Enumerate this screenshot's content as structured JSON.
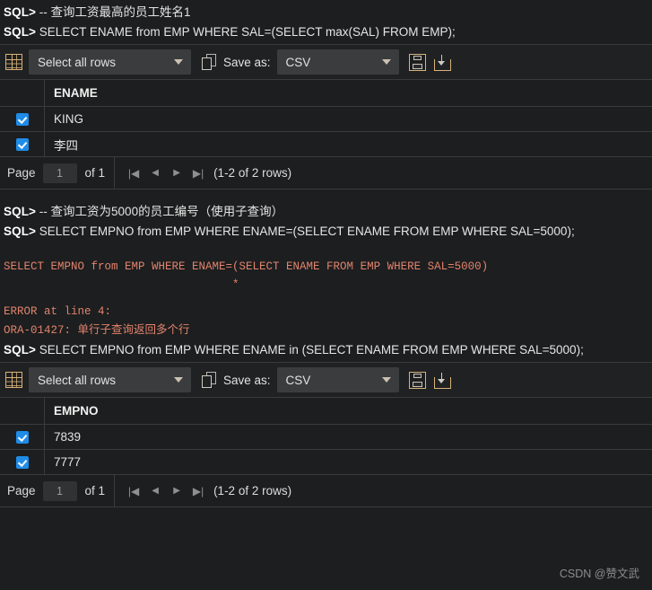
{
  "console_top": {
    "lines": [
      {
        "prompt": "SQL>",
        "text": " -- 查询工资最高的员工姓名1",
        "kind": "comment"
      },
      {
        "prompt": "SQL>",
        "text": " SELECT ENAME from EMP WHERE SAL=(SELECT max(SAL) FROM EMP);",
        "kind": "stmt"
      }
    ]
  },
  "result_top": {
    "toolbar": {
      "grid_icon": "grid-icon",
      "rows_select_value": "Select all rows",
      "copy_icon": "copy-pages-icon",
      "save_as_label": "Save as:",
      "format_value": "CSV",
      "save_icon": "floppy-disk-icon",
      "download_icon": "download-icon"
    },
    "columns": [
      "ENAME"
    ],
    "rows": [
      {
        "checked": true,
        "value": "KING"
      },
      {
        "checked": true,
        "value": "李四"
      }
    ],
    "pager": {
      "page_label": "Page",
      "page_value": "1",
      "of_label": "of 1",
      "first_icon": "|◀",
      "prev_icon": "◀",
      "next_icon": "▶",
      "last_icon": "▶|",
      "row_count": "(1-2 of 2 rows)"
    }
  },
  "console_mid": {
    "lines": [
      {
        "prompt": "SQL>",
        "text": " -- 查询工资为5000的员工编号（使用子查询）",
        "kind": "comment"
      },
      {
        "prompt": "SQL>",
        "text": " SELECT EMPNO from EMP WHERE ENAME=(SELECT ENAME FROM EMP WHERE SAL=5000);",
        "kind": "stmt"
      }
    ],
    "error": {
      "echo": "SELECT EMPNO from EMP WHERE ENAME=(SELECT ENAME FROM EMP WHERE SAL=5000)",
      "marker": "                                  *",
      "line1": "ERROR at line 4:",
      "line2": "ORA-01427: 单行子查询返回多个行"
    },
    "after": [
      {
        "prompt": "SQL>",
        "text": " SELECT EMPNO from EMP WHERE ENAME in (SELECT ENAME FROM EMP WHERE SAL=5000);",
        "kind": "stmt"
      }
    ]
  },
  "result_bottom": {
    "toolbar": {
      "grid_icon": "grid-icon",
      "rows_select_value": "Select all rows",
      "copy_icon": "copy-pages-icon",
      "save_as_label": "Save as:",
      "format_value": "CSV",
      "save_icon": "floppy-disk-icon",
      "download_icon": "download-icon"
    },
    "columns": [
      "EMPNO"
    ],
    "rows": [
      {
        "checked": true,
        "value": "7839"
      },
      {
        "checked": true,
        "value": "7777"
      }
    ],
    "pager": {
      "page_label": "Page",
      "page_value": "1",
      "of_label": "of 1",
      "first_icon": "|◀",
      "prev_icon": "◀",
      "next_icon": "▶",
      "last_icon": "▶|",
      "row_count": "(1-2 of 2 rows)"
    }
  },
  "watermark": "CSDN @赞文武",
  "colors": {
    "background": "#1d1e1f",
    "panel": "#202123",
    "border": "#3a3b3d",
    "error_text": "#e0836d",
    "checkbox": "#1f8ce8",
    "icon_accent": "#d8b27a"
  }
}
